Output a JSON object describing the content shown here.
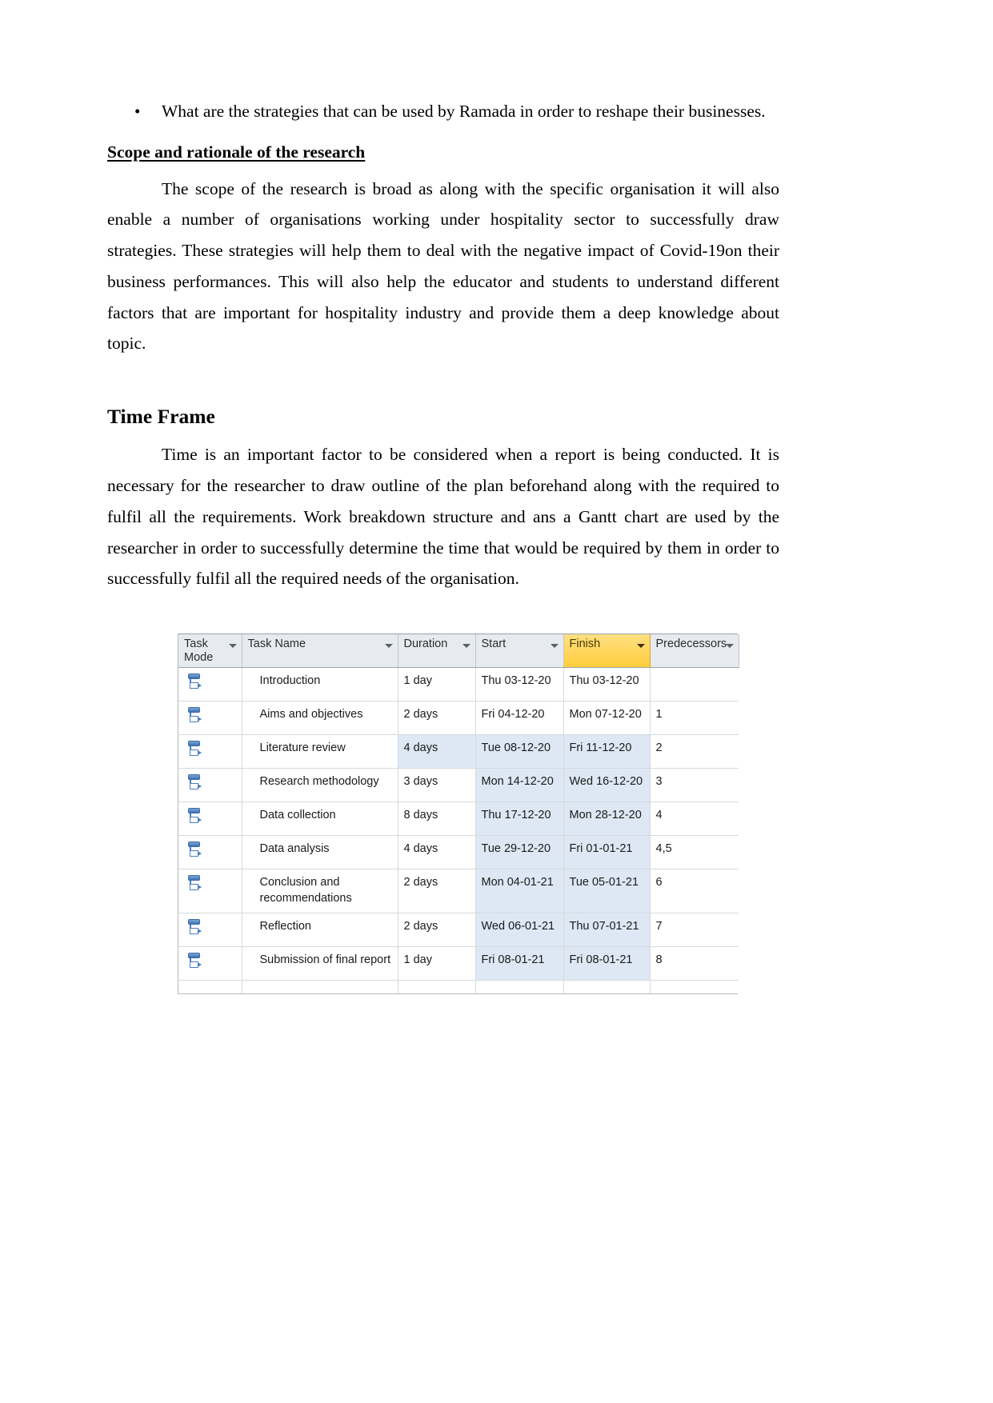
{
  "document": {
    "bullet_items": [
      "What are the strategies that can be used by Ramada in order to reshape their businesses."
    ],
    "section_scope": {
      "heading": "Scope and rationale of the research",
      "paragraph": "The scope of the research is broad as along with the specific organisation it will also enable a number of organisations working under hospitality sector to successfully draw strategies. These strategies will help them to deal with the negative impact of Covid-19on their business performances. This will also help the educator and students to understand different factors that are important for hospitality industry and provide them a deep knowledge about topic."
    },
    "section_timeframe": {
      "heading": "Time Frame",
      "paragraph": "Time is an important factor to be considered when a report is being conducted. It is necessary for the researcher to draw outline of the plan beforehand along with the required to fulfil all the requirements. Work breakdown structure and ans a Gantt chart are used by the researcher in order to successfully determine the time that would be required by them in order to successfully fulfil all the required needs of the organisation."
    }
  },
  "project_table": {
    "colors": {
      "header_background": "#e7ebef",
      "header_highlight": "#ffcd3c",
      "cell_shaded": "#dde8f4",
      "grid_line": "#d6dade",
      "task_mode_icon": "#4a7fbe"
    },
    "columns": [
      {
        "key": "mode",
        "label": "Task Mode",
        "highlighted": false
      },
      {
        "key": "name",
        "label": "Task Name",
        "highlighted": false
      },
      {
        "key": "duration",
        "label": "Duration",
        "highlighted": false
      },
      {
        "key": "start",
        "label": "Start",
        "highlighted": false
      },
      {
        "key": "finish",
        "label": "Finish",
        "highlighted": true
      },
      {
        "key": "pred",
        "label": "Predecessors",
        "highlighted": false
      }
    ],
    "rows": [
      {
        "mode_icon": "auto-scheduled-icon",
        "name": "Introduction",
        "duration": "1 day",
        "start": "Thu 03-12-20",
        "finish": "Thu 03-12-20",
        "pred": "",
        "shading": {
          "duration": false,
          "start": false,
          "finish": false
        }
      },
      {
        "mode_icon": "auto-scheduled-icon",
        "name": "Aims and objectives",
        "duration": "2 days",
        "start": "Fri 04-12-20",
        "finish": "Mon 07-12-20",
        "pred": "1",
        "shading": {
          "duration": false,
          "start": false,
          "finish": false
        }
      },
      {
        "mode_icon": "auto-scheduled-icon",
        "name": "Literature review",
        "duration": "4 days",
        "start": "Tue 08-12-20",
        "finish": "Fri 11-12-20",
        "pred": "2",
        "shading": {
          "duration": true,
          "start": true,
          "finish": true
        }
      },
      {
        "mode_icon": "auto-scheduled-icon",
        "name": "Research methodology",
        "duration": "3 days",
        "start": "Mon 14-12-20",
        "finish": "Wed 16-12-20",
        "pred": "3",
        "shading": {
          "duration": false,
          "start": true,
          "finish": true
        }
      },
      {
        "mode_icon": "auto-scheduled-icon",
        "name": "Data collection",
        "duration": "8 days",
        "start": "Thu 17-12-20",
        "finish": "Mon 28-12-20",
        "pred": "4",
        "shading": {
          "duration": false,
          "start": true,
          "finish": true
        }
      },
      {
        "mode_icon": "auto-scheduled-icon",
        "name": "Data analysis",
        "duration": "4 days",
        "start": "Tue 29-12-20",
        "finish": "Fri 01-01-21",
        "pred": "4,5",
        "shading": {
          "duration": false,
          "start": true,
          "finish": true
        }
      },
      {
        "mode_icon": "auto-scheduled-icon",
        "name": "Conclusion and recommendations",
        "duration": "2 days",
        "start": "Mon 04-01-21",
        "finish": "Tue 05-01-21",
        "pred": "6",
        "shading": {
          "duration": false,
          "start": true,
          "finish": true
        }
      },
      {
        "mode_icon": "auto-scheduled-icon",
        "name": "Reflection",
        "duration": "2 days",
        "start": "Wed 06-01-21",
        "finish": "Thu 07-01-21",
        "pred": "7",
        "shading": {
          "duration": false,
          "start": true,
          "finish": true
        }
      },
      {
        "mode_icon": "auto-scheduled-icon",
        "name": "Submission of final report",
        "duration": "1 day",
        "start": "Fri 08-01-21",
        "finish": "Fri 08-01-21",
        "pred": "8",
        "shading": {
          "duration": false,
          "start": true,
          "finish": true
        }
      }
    ]
  }
}
